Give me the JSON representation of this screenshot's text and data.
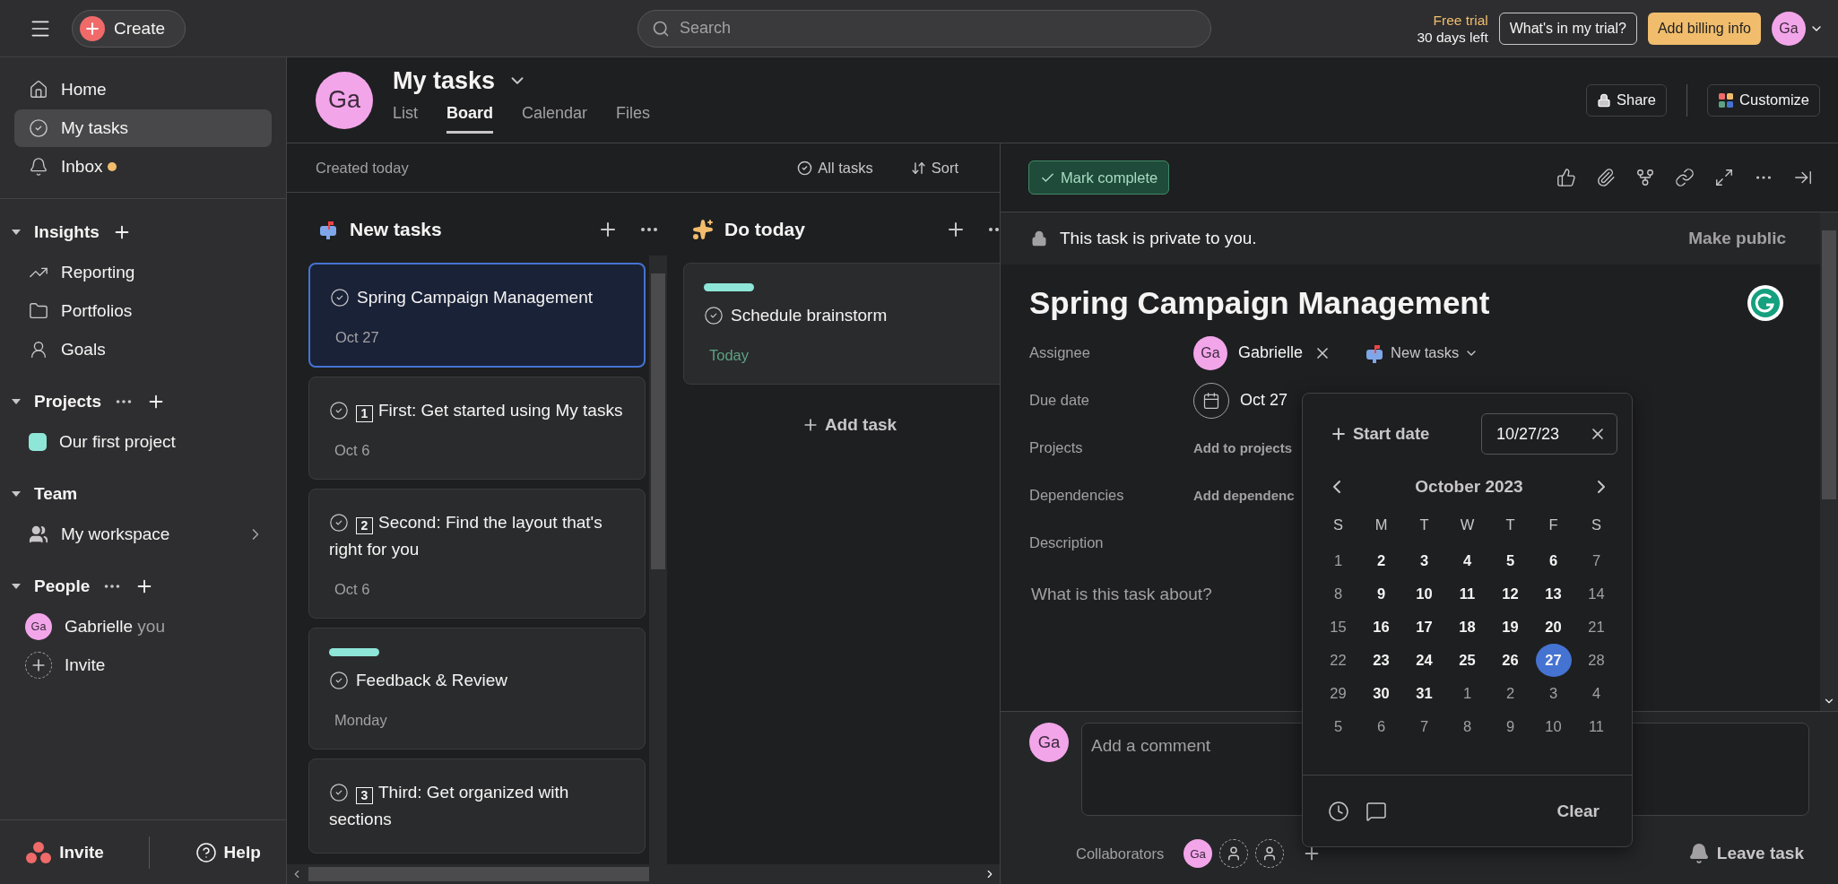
{
  "topbar": {
    "create": "Create",
    "search": {
      "placeholder": "Search"
    },
    "trial_label": "Free trial",
    "trial_days": "30 days left",
    "trial_button": "What's in my trial?",
    "billing_button": "Add billing info",
    "avatar": "Ga"
  },
  "sidebar": {
    "nav": [
      {
        "label": "Home",
        "selected": false,
        "unread": false
      },
      {
        "label": "My tasks",
        "selected": true,
        "unread": false
      },
      {
        "label": "Inbox",
        "selected": false,
        "unread": true
      }
    ],
    "sections": [
      {
        "title": "Insights",
        "more": false,
        "add": true,
        "items": [
          {
            "kind": "link",
            "label": "Reporting"
          },
          {
            "kind": "link",
            "label": "Portfolios"
          },
          {
            "kind": "link",
            "label": "Goals"
          }
        ]
      },
      {
        "title": "Projects",
        "more": true,
        "add": true,
        "items": [
          {
            "kind": "project",
            "label": "Our first project"
          }
        ]
      },
      {
        "title": "Team",
        "more": false,
        "add": false,
        "items": [
          {
            "kind": "team",
            "label": "My workspace"
          }
        ]
      },
      {
        "title": "People",
        "more": true,
        "add": true,
        "items": [
          {
            "kind": "person",
            "avatar": "Ga",
            "label": "Gabrielle",
            "note": "you"
          },
          {
            "kind": "invite",
            "label": "Invite"
          }
        ]
      }
    ],
    "footer": {
      "invite": "Invite",
      "help": "Help"
    }
  },
  "header": {
    "avatar": "Ga",
    "title": "My tasks",
    "tabs": [
      {
        "label": "List",
        "selected": false
      },
      {
        "label": "Board",
        "selected": true
      },
      {
        "label": "Calendar",
        "selected": false
      },
      {
        "label": "Files",
        "selected": false
      }
    ],
    "share": "Share",
    "customize": "Customize"
  },
  "board": {
    "note": "Created today",
    "filter": "All tasks",
    "sort": "Sort",
    "columns": [
      {
        "title": "New tasks",
        "cards": [
          {
            "title": "Spring Campaign Management",
            "date": "Oct 27",
            "selected": true,
            "tagged": false,
            "today": false
          },
          {
            "step": "1",
            "title": "First: Get started using My tasks",
            "date": "Oct 6",
            "selected": false,
            "tagged": false,
            "today": false
          },
          {
            "step": "2",
            "title": "Second: Find the layout that's right for you",
            "date": "Oct 6",
            "selected": false,
            "tagged": false,
            "today": false
          },
          {
            "title": "Feedback & Review",
            "date": "Monday",
            "selected": false,
            "tagged": true,
            "today": false
          },
          {
            "step": "3",
            "title": "Third: Get organized with sections",
            "selected": false,
            "tagged": false
          }
        ]
      },
      {
        "title": "Do today",
        "add_task": "Add task",
        "cards": [
          {
            "title": "Schedule brainstorm",
            "date": "Today",
            "selected": false,
            "tagged": true,
            "today": true
          }
        ]
      }
    ]
  },
  "detail": {
    "mark_complete": "Mark complete",
    "private_note": "This task is private to you.",
    "make_public": "Make public",
    "title": "Spring Campaign Management",
    "fields": [
      {
        "kind": "assignee",
        "label": "Assignee",
        "avatar": "Ga",
        "value": "Gabrielle",
        "project": "New tasks"
      },
      {
        "kind": "date",
        "label": "Due date",
        "value": "Oct 27"
      },
      {
        "kind": "action",
        "label": "Projects",
        "value": "Add to projects"
      },
      {
        "kind": "action",
        "label": "Dependencies",
        "value": "Add dependenc"
      },
      {
        "kind": "heading",
        "label": "Description"
      }
    ],
    "description": {
      "placeholder": "What is this task about?"
    },
    "comment": {
      "avatar": "Ga",
      "placeholder": "Add a comment"
    },
    "collaborators": {
      "label": "Collaborators",
      "avatar": "Ga"
    },
    "leave": "Leave task"
  },
  "datepicker": {
    "start_date": "Start date",
    "date_field": "10/27/23",
    "month": "October 2023",
    "weekdays": [
      "S",
      "M",
      "T",
      "W",
      "T",
      "F",
      "S"
    ],
    "weeks": [
      [
        {
          "day": "1",
          "muted": true,
          "selected": false
        },
        {
          "day": "2",
          "muted": false,
          "selected": false
        },
        {
          "day": "3",
          "muted": false,
          "selected": false
        },
        {
          "day": "4",
          "muted": false,
          "selected": false
        },
        {
          "day": "5",
          "muted": false,
          "selected": false
        },
        {
          "day": "6",
          "muted": false,
          "selected": false
        },
        {
          "day": "7",
          "muted": true,
          "selected": false
        }
      ],
      [
        {
          "day": "8",
          "muted": true,
          "selected": false
        },
        {
          "day": "9",
          "muted": false,
          "selected": false
        },
        {
          "day": "10",
          "muted": false,
          "selected": false
        },
        {
          "day": "11",
          "muted": false,
          "selected": false
        },
        {
          "day": "12",
          "muted": false,
          "selected": false
        },
        {
          "day": "13",
          "muted": false,
          "selected": false
        },
        {
          "day": "14",
          "muted": true,
          "selected": false
        }
      ],
      [
        {
          "day": "15",
          "muted": true,
          "selected": false
        },
        {
          "day": "16",
          "muted": false,
          "selected": false
        },
        {
          "day": "17",
          "muted": false,
          "selected": false
        },
        {
          "day": "18",
          "muted": false,
          "selected": false
        },
        {
          "day": "19",
          "muted": false,
          "selected": false
        },
        {
          "day": "20",
          "muted": false,
          "selected": false
        },
        {
          "day": "21",
          "muted": true,
          "selected": false
        }
      ],
      [
        {
          "day": "22",
          "muted": true,
          "selected": false
        },
        {
          "day": "23",
          "muted": false,
          "selected": false
        },
        {
          "day": "24",
          "muted": false,
          "selected": false
        },
        {
          "day": "25",
          "muted": false,
          "selected": false
        },
        {
          "day": "26",
          "muted": false,
          "selected": false
        },
        {
          "day": "27",
          "muted": false,
          "selected": true
        },
        {
          "day": "28",
          "muted": true,
          "selected": false
        }
      ],
      [
        {
          "day": "29",
          "muted": true,
          "selected": false
        },
        {
          "day": "30",
          "muted": false,
          "selected": false
        },
        {
          "day": "31",
          "muted": false,
          "selected": false
        },
        {
          "day": "1",
          "muted": true,
          "selected": false
        },
        {
          "day": "2",
          "muted": true,
          "selected": false
        },
        {
          "day": "3",
          "muted": true,
          "selected": false
        },
        {
          "day": "4",
          "muted": true,
          "selected": false
        }
      ],
      [
        {
          "day": "5",
          "muted": true,
          "selected": false
        },
        {
          "day": "6",
          "muted": true,
          "selected": false
        },
        {
          "day": "7",
          "muted": true,
          "selected": false
        },
        {
          "day": "8",
          "muted": true,
          "selected": false
        },
        {
          "day": "9",
          "muted": true,
          "selected": false
        },
        {
          "day": "10",
          "muted": true,
          "selected": false
        },
        {
          "day": "11",
          "muted": true,
          "selected": false
        }
      ]
    ],
    "clear": "Clear"
  }
}
